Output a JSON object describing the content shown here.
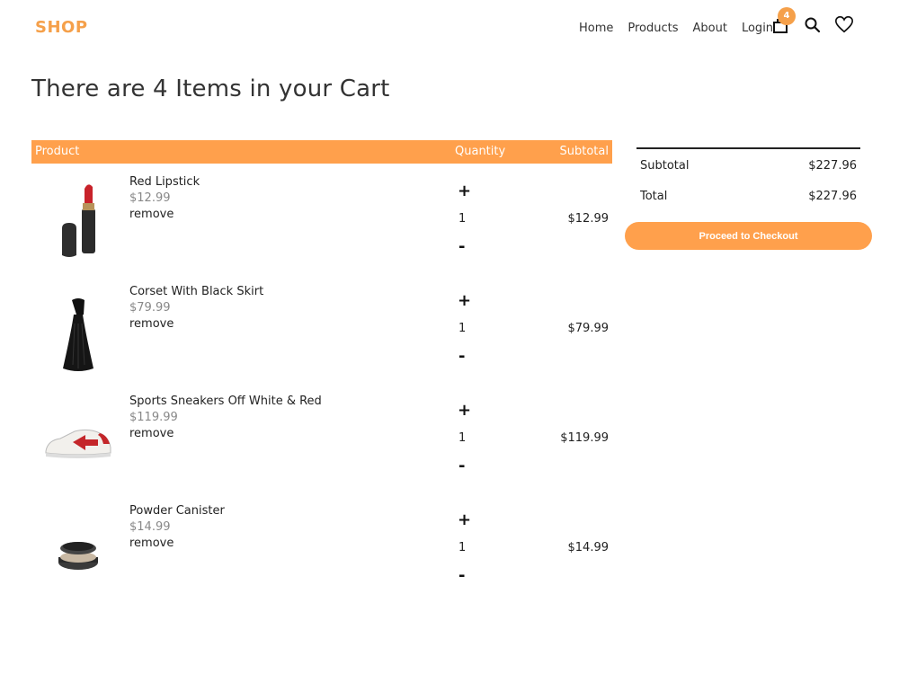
{
  "header": {
    "logo": "SHOP",
    "nav": [
      "Home",
      "Products",
      "About",
      "Login"
    ],
    "cart_count": "4",
    "accent_color": "#ffa04c"
  },
  "page_title": "There are 4 Items in your Cart",
  "table": {
    "headers": {
      "product": "Product",
      "quantity": "Quantity",
      "subtotal": "Subtotal"
    },
    "remove_label": "remove",
    "plus_label": "+",
    "minus_label": "-",
    "items": [
      {
        "name": "Red Lipstick",
        "price": "$12.99",
        "qty": "1",
        "subtotal": "$12.99",
        "icon": "lipstick-icon"
      },
      {
        "name": "Corset With Black Skirt",
        "price": "$79.99",
        "qty": "1",
        "subtotal": "$79.99",
        "icon": "dress-icon"
      },
      {
        "name": "Sports Sneakers Off White & Red",
        "price": "$119.99",
        "qty": "1",
        "subtotal": "$119.99",
        "icon": "sneaker-icon"
      },
      {
        "name": "Powder Canister",
        "price": "$14.99",
        "qty": "1",
        "subtotal": "$14.99",
        "icon": "powder-icon"
      }
    ]
  },
  "summary": {
    "subtotal_label": "Subtotal",
    "subtotal_value": "$227.96",
    "total_label": "Total",
    "total_value": "$227.96",
    "checkout_label": "Proceed to Checkout"
  }
}
